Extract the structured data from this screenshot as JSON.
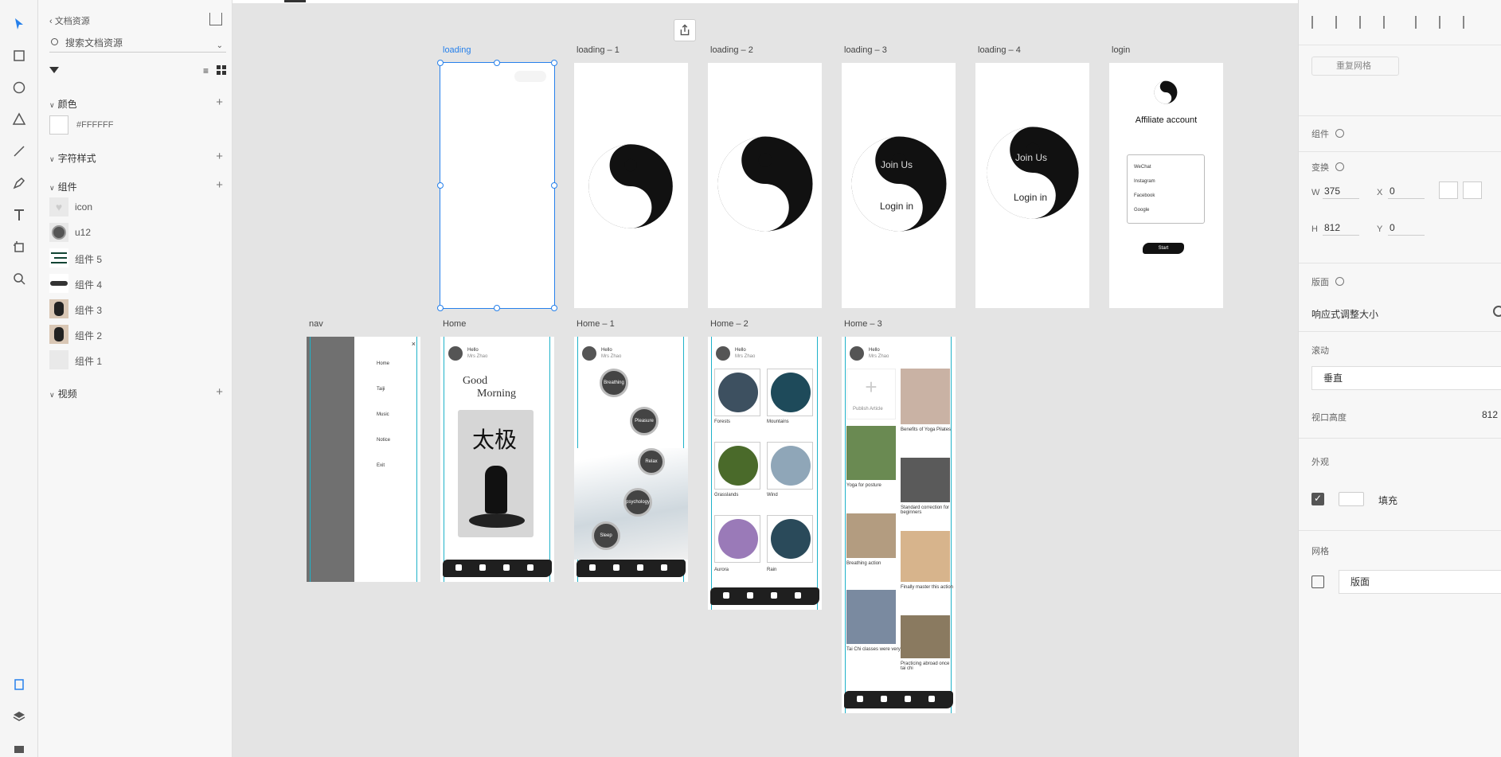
{
  "assets": {
    "back_label": "文档资源",
    "search_placeholder": "搜索文档资源",
    "sections": {
      "colors": "颜色",
      "char_styles": "字符样式",
      "components": "组件",
      "videos": "视频"
    },
    "color_hex": "#FFFFFF",
    "components": [
      {
        "label": "icon"
      },
      {
        "label": "u12"
      },
      {
        "label": "组件 5"
      },
      {
        "label": "组件 4"
      },
      {
        "label": "组件 3"
      },
      {
        "label": "组件 2"
      },
      {
        "label": "组件 1"
      }
    ]
  },
  "artboards": {
    "loading": "loading",
    "loading1": "loading – 1",
    "loading2": "loading – 2",
    "loading3": "loading – 3",
    "loading4": "loading – 4",
    "login": "login",
    "nav": "nav",
    "home": "Home",
    "home1": "Home – 1",
    "home2": "Home – 2",
    "home3": "Home – 3"
  },
  "screens": {
    "join_us": "Join Us",
    "login_in": "Login in",
    "affiliate": "Affiliate account",
    "social": [
      "WeChat",
      "Instagram",
      "Facebook",
      "Google"
    ],
    "start": "Start",
    "nav_items": [
      "Home",
      "Taiji",
      "Music",
      "Notice",
      "Exit"
    ],
    "greeting": "Hello",
    "user": "Mrs Zhao",
    "good": "Good",
    "morning": "Morning",
    "calligraphy": "太极",
    "bubbles": [
      "Breathing",
      "Pleasure",
      "Relax",
      "psychology",
      "Sleep"
    ],
    "home2_labels": [
      "Forests",
      "Mountains",
      "Grasslands",
      "Wind",
      "Aurora",
      "Rain"
    ],
    "home3_publish": "Publish Article",
    "home3_captions": [
      "Benefits of Yoga Pilates",
      "Yoga for posture",
      "Breathing action",
      "Standard correction for beginners",
      "Finally master this action",
      "Tai Chi classes were very useful",
      "Practicing abroad once tai chi"
    ]
  },
  "props": {
    "repeat_grid": "重复网格",
    "component": "组件",
    "transform": "变换",
    "w_label": "W",
    "w_value": "375",
    "x_label": "X",
    "x_value": "0",
    "h_label": "H",
    "h_value": "812",
    "y_label": "Y",
    "y_value": "0",
    "layout": "版面",
    "responsive": "响应式调整大小",
    "scroll": "滚动",
    "scroll_value": "垂直",
    "viewport_height": "视口高度",
    "viewport_value": "812",
    "appearance": "外观",
    "fill": "填充",
    "grid": "网格",
    "grid_value": "版面"
  },
  "colors": {
    "selection": "#2680eb",
    "guide": "#1fb2c9"
  }
}
